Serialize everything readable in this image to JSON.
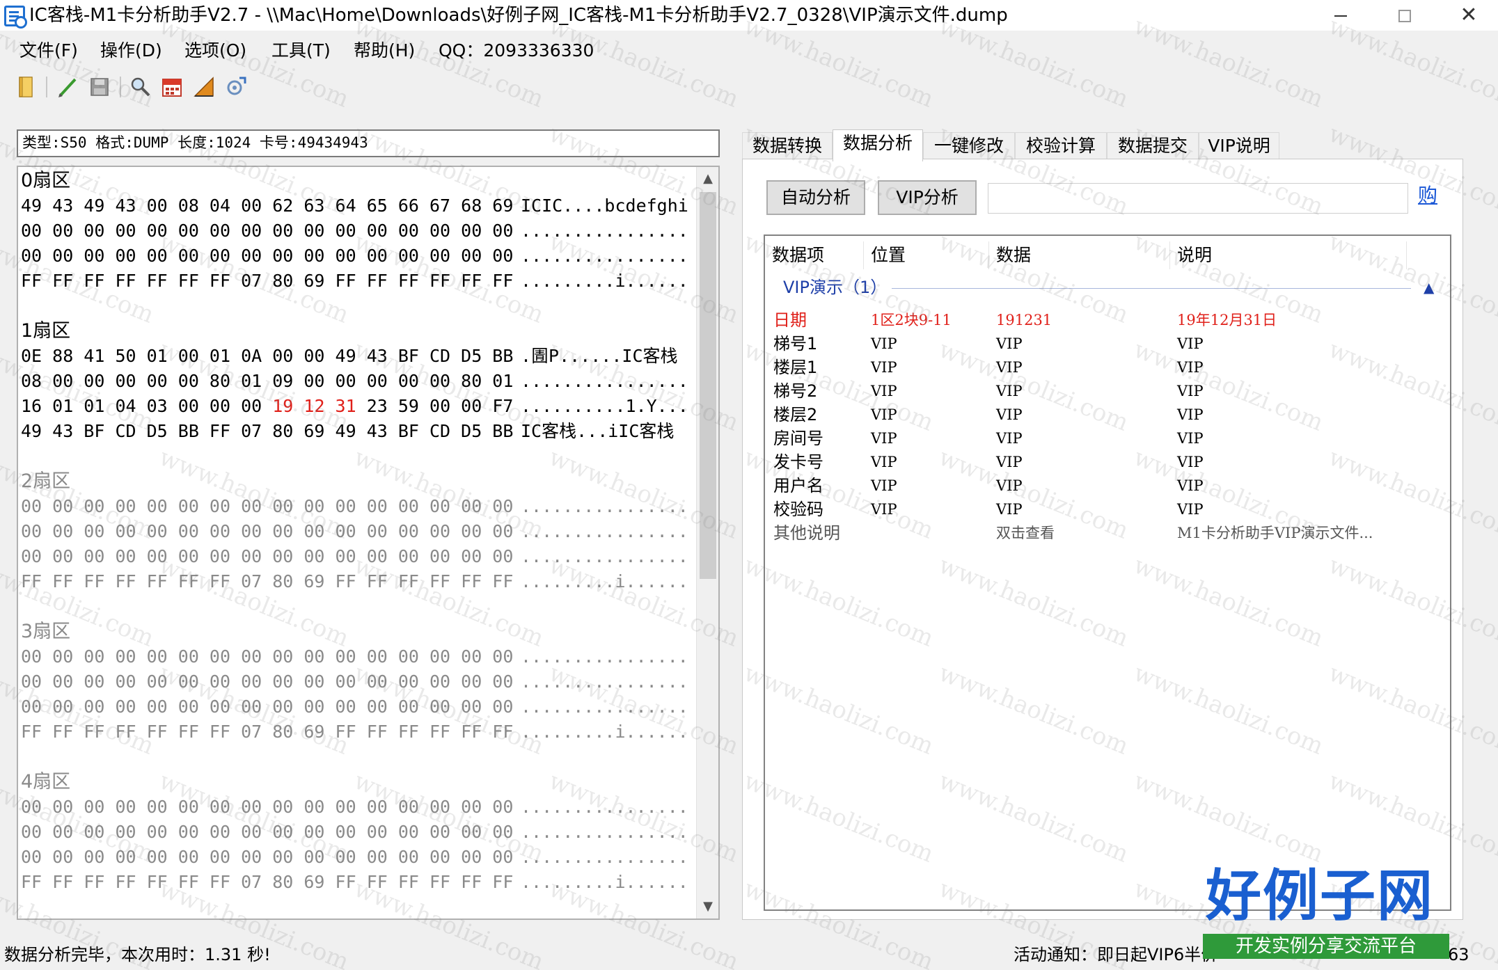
{
  "window": {
    "title": "IC客栈-M1卡分析助手V2.7 - \\\\Mac\\Home\\Downloads\\好例子网_IC客栈-M1卡分析助手V2.7_0328\\VIP演示文件.dump"
  },
  "menu": [
    "文件(F)",
    "操作(D)",
    "选项(O)",
    "工具(T)",
    "帮助(H)",
    "QQ：2093336330"
  ],
  "toolbar_icons": [
    "open-folder-icon",
    "pencil-icon",
    "save-icon",
    "search-icon",
    "calendar-icon",
    "chart-icon",
    "settings-icon"
  ],
  "info_bar": "类型:S50 格式:DUMP 长度:1024 卡号:49434943",
  "hex_view": {
    "sectors": [
      {
        "title": "0扇区",
        "dim": false,
        "lines": [
          {
            "hex": "49 43 49 43 00 08 04 00 62 63 64 65 66 67 68 69",
            "ascii": "ICIC....bcdefghi"
          },
          {
            "hex": "00 00 00 00 00 00 00 00 00 00 00 00 00 00 00 00",
            "ascii": "................"
          },
          {
            "hex": "00 00 00 00 00 00 00 00 00 00 00 00 00 00 00 00",
            "ascii": "................"
          },
          {
            "hex": "FF FF FF FF FF FF FF 07 80 69 FF FF FF FF FF FF",
            "ascii": ".........i......"
          }
        ]
      },
      {
        "title": "1扇区",
        "dim": false,
        "lines": [
          {
            "hex": "0E 88 41 50 01 00 01 0A 00 00 49 43 BF CD D5 BB",
            "ascii": ".圊P......IC客栈"
          },
          {
            "hex": "08 00 00 00 00 00 80 01 09 00 00 00 00 00 80 01",
            "ascii": "................"
          },
          {
            "hex_pre": "16 01 01 04 03 00 00 00 ",
            "hex_hl": "19 12 31",
            "hex_post": " 23 59 00 00 F7",
            "ascii": "..........1.Y..."
          },
          {
            "hex": "49 43 BF CD D5 BB FF 07 80 69 49 43 BF CD D5 BB",
            "ascii": "IC客栈...iIC客栈"
          }
        ]
      },
      {
        "title": "2扇区",
        "dim": true,
        "lines": [
          {
            "hex": "00 00 00 00 00 00 00 00 00 00 00 00 00 00 00 00",
            "ascii": "................"
          },
          {
            "hex": "00 00 00 00 00 00 00 00 00 00 00 00 00 00 00 00",
            "ascii": "................"
          },
          {
            "hex": "00 00 00 00 00 00 00 00 00 00 00 00 00 00 00 00",
            "ascii": "................"
          },
          {
            "hex": "FF FF FF FF FF FF FF 07 80 69 FF FF FF FF FF FF",
            "ascii": ".........i......"
          }
        ]
      },
      {
        "title": "3扇区",
        "dim": true,
        "lines": [
          {
            "hex": "00 00 00 00 00 00 00 00 00 00 00 00 00 00 00 00",
            "ascii": "................"
          },
          {
            "hex": "00 00 00 00 00 00 00 00 00 00 00 00 00 00 00 00",
            "ascii": "................"
          },
          {
            "hex": "00 00 00 00 00 00 00 00 00 00 00 00 00 00 00 00",
            "ascii": "................"
          },
          {
            "hex": "FF FF FF FF FF FF FF 07 80 69 FF FF FF FF FF FF",
            "ascii": ".........i......"
          }
        ]
      },
      {
        "title": "4扇区",
        "dim": true,
        "lines": [
          {
            "hex": "00 00 00 00 00 00 00 00 00 00 00 00 00 00 00 00",
            "ascii": "................"
          },
          {
            "hex": "00 00 00 00 00 00 00 00 00 00 00 00 00 00 00 00",
            "ascii": "................"
          },
          {
            "hex": "00 00 00 00 00 00 00 00 00 00 00 00 00 00 00 00",
            "ascii": "................"
          },
          {
            "hex": "FF FF FF FF FF FF FF 07 80 69 FF FF FF FF FF FF",
            "ascii": ".........i......"
          }
        ]
      }
    ]
  },
  "tabs": [
    "数据转换",
    "数据分析",
    "一键修改",
    "校验计算",
    "数据提交",
    "VIP说明"
  ],
  "active_tab": 1,
  "analysis": {
    "auto_button": "自动分析",
    "vip_button": "VIP分析",
    "input_value": "",
    "buy_link": "购",
    "columns": [
      "数据项",
      "位置",
      "数据",
      "说明"
    ],
    "group_title": "VIP演示（1）",
    "rows": [
      {
        "item": "日期",
        "position": "1区2块9-11",
        "data": "191231",
        "desc": "19年12月31日",
        "style": "hl"
      },
      {
        "item": "梯号1",
        "position": "VIP",
        "data": "VIP",
        "desc": "VIP",
        "style": ""
      },
      {
        "item": "楼层1",
        "position": "VIP",
        "data": "VIP",
        "desc": "VIP",
        "style": ""
      },
      {
        "item": "梯号2",
        "position": "VIP",
        "data": "VIP",
        "desc": "VIP",
        "style": ""
      },
      {
        "item": "楼层2",
        "position": "VIP",
        "data": "VIP",
        "desc": "VIP",
        "style": ""
      },
      {
        "item": "房间号",
        "position": "VIP",
        "data": "VIP",
        "desc": "VIP",
        "style": ""
      },
      {
        "item": "发卡号",
        "position": "VIP",
        "data": "VIP",
        "desc": "VIP",
        "style": ""
      },
      {
        "item": "用户名",
        "position": "VIP",
        "data": "VIP",
        "desc": "VIP",
        "style": ""
      },
      {
        "item": "校验码",
        "position": "VIP",
        "data": "VIP",
        "desc": "VIP",
        "style": ""
      },
      {
        "item": "其他说明",
        "position": "",
        "data": "双击查看",
        "desc": "M1卡分析助手VIP演示文件...",
        "style": "note"
      }
    ]
  },
  "status": {
    "left": "数据分析完毕，本次用时：1.31 秒!",
    "right": "活动通知：即日起VIP6半价",
    "tail": "63"
  },
  "watermark": {
    "text": "www.haolizi.com",
    "brand_big": "好例子网",
    "brand_small": "开发实例分享交流平台"
  },
  "colors": {
    "highlight_red": "#e0201a",
    "group_blue": "#1e3fa8",
    "link_blue": "#1a57d6",
    "brand_blue": "#1a5fd0",
    "brand_green": "#2f9a3a"
  }
}
